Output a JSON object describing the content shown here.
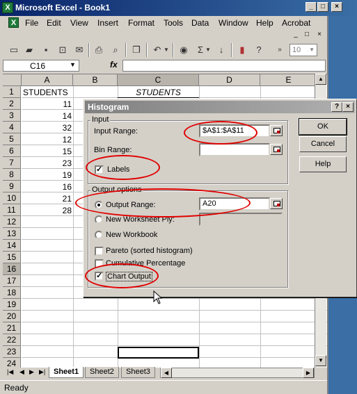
{
  "window": {
    "title": "Microsoft Excel - Book1",
    "caption_buttons": [
      "_",
      "□",
      "×"
    ]
  },
  "menubar": {
    "items": [
      "File",
      "Edit",
      "View",
      "Insert",
      "Format",
      "Tools",
      "Data",
      "Window",
      "Help",
      "Acrobat"
    ],
    "doc_buttons": [
      "_",
      "□",
      "×"
    ]
  },
  "toolbar": {
    "font_size": "10",
    "icons": [
      "new-icon",
      "open-icon",
      "save-icon",
      "permission-icon",
      "email-icon",
      "print-icon",
      "print-preview-icon",
      "copy-icon",
      "undo-icon",
      "hyperlink-icon",
      "autosum-icon",
      "sort-icon",
      "chart-icon",
      "help-icon"
    ]
  },
  "formula_bar": {
    "name_box": "C16",
    "fx_label": "fx",
    "formula": ""
  },
  "grid": {
    "columns": [
      "A",
      "B",
      "C",
      "D",
      "E"
    ],
    "rows": [
      "1",
      "2",
      "3",
      "4",
      "5",
      "6",
      "7",
      "8",
      "9",
      "10",
      "11",
      "12",
      "13",
      "14",
      "15",
      "16",
      "17",
      "18",
      "19",
      "20",
      "21",
      "22",
      "23",
      "24"
    ],
    "a1": "STUDENTS",
    "c1": "STUDENTS",
    "values": [
      "11",
      "14",
      "32",
      "12",
      "15",
      "23",
      "19",
      "16",
      "21",
      "28"
    ]
  },
  "sheet_tabs": [
    "Sheet1",
    "Sheet2",
    "Sheet3"
  ],
  "status": "Ready",
  "dialog": {
    "title": "Histogram",
    "help_btn": "?",
    "close_btn": "×",
    "input_group": "Input",
    "input_range_label": "Input Range:",
    "input_range_value": "$A$1:$A$11",
    "bin_range_label": "Bin Range:",
    "bin_range_value": "",
    "labels_label": "Labels",
    "labels_checked": "✓",
    "output_group": "Output options",
    "output_range_label": "Output Range:",
    "output_range_value": "A20",
    "new_ply_label": "New Worksheet Ply:",
    "new_workbook_label": "New Workbook",
    "pareto_label": "Pareto (sorted histogram)",
    "cumulative_label": "Cumulative Percentage",
    "chart_output_label": "Chart Output",
    "chart_output_checked": "✓",
    "ok_label": "OK",
    "cancel_label": "Cancel",
    "help_label": "Help"
  },
  "colors": {
    "annotation": "#e00000",
    "title_active": "#0a246a",
    "title_inactive": "#808080"
  }
}
